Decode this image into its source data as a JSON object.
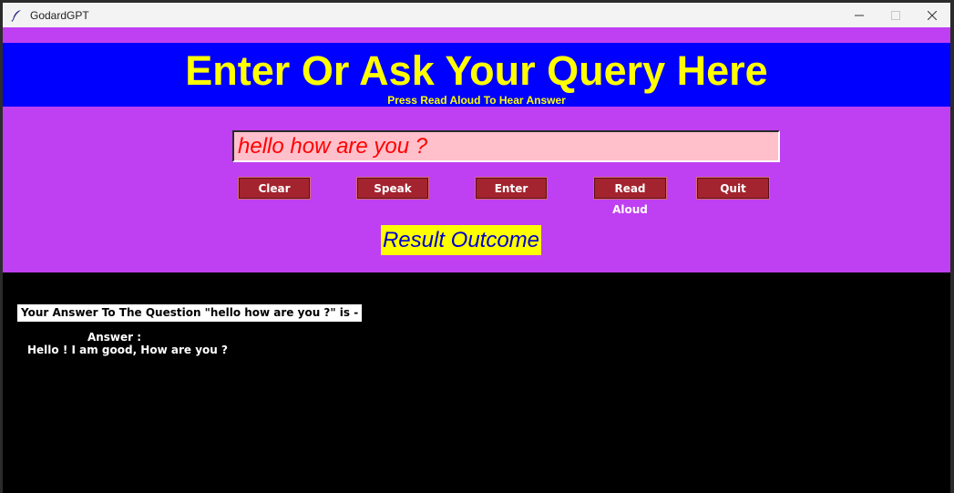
{
  "window": {
    "title": "GodardGPT",
    "icon": "feather-icon",
    "controls": [
      "minimize-icon",
      "maximize-icon",
      "close-icon"
    ]
  },
  "banner": {
    "title": "Enter Or Ask Your Query Here",
    "subtitle": "Press Read Aloud To Hear Answer"
  },
  "query": {
    "value": "hello how are you ?"
  },
  "buttons": {
    "clear": "Clear",
    "speak": "Speak",
    "enter": "Enter",
    "read_aloud": "Read Aloud",
    "quit": "Quit"
  },
  "result": {
    "label": "Result Outcome",
    "question_line": "Your Answer To The Question \"hello how are you ?\" is -",
    "answer_heading": "Answer :",
    "answer_text": "Hello ! I am good, How are you ?"
  },
  "colors": {
    "purple": "#bf3ff2",
    "banner_blue": "#0000ff",
    "banner_text_yellow": "#ffff00",
    "input_bg_pink": "#ffc0cb",
    "input_text_red": "#ff0000",
    "button_maroon": "#a3242f",
    "result_bg_yellow": "#ffff00",
    "result_text_blue": "#0000cc",
    "output_bg_black": "#000000"
  }
}
